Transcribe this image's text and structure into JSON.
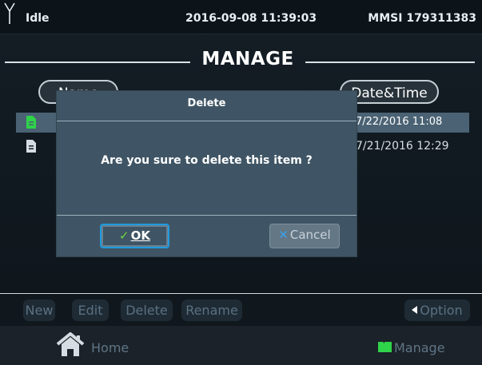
{
  "status_bar": {
    "state": "Idle",
    "datetime": "2016-09-08 11:39:03",
    "mmsi": "MMSI 179311383"
  },
  "page": {
    "title": "MANAGE"
  },
  "columns": {
    "name_label": "Name",
    "date_label": "Date&Time"
  },
  "files": [
    {
      "datetime": "7/22/2016 11:08",
      "selected": true,
      "icon": "document-icon",
      "icon_color": "#2fd34a"
    },
    {
      "datetime": "7/21/2016 12:29",
      "selected": false,
      "icon": "document-icon",
      "icon_color": "#d6dde2"
    }
  ],
  "dialog": {
    "title": "Delete",
    "message": "Are you sure to delete this item ?",
    "ok_prefix": "✓",
    "ok_label": "OK",
    "cancel_prefix": "✕",
    "cancel_label": "Cancel"
  },
  "toolbar": {
    "new_label": "New",
    "edit_label": "Edit",
    "delete_label": "Delete",
    "rename_label": "Rename",
    "option_label": "Option"
  },
  "nav": {
    "home_label": "Home",
    "manage_label": "Manage"
  },
  "colors": {
    "accent_blue": "#1d9be0",
    "accent_green": "#2fd34a",
    "selected_row": "#4a6273",
    "dialog_bg": "#3f5565"
  }
}
